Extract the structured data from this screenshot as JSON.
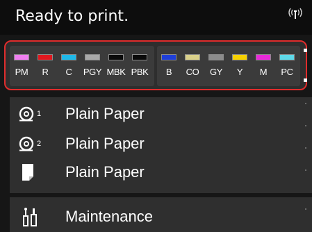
{
  "header": {
    "status_text": "Ready to print.",
    "wifi_icon": "wifi-icon"
  },
  "ink_panel": {
    "border_color": "#e02c2c",
    "left_group": [
      {
        "label": "PM",
        "color": "#f07ff0"
      },
      {
        "label": "R",
        "color": "#e0181f"
      },
      {
        "label": "C",
        "color": "#1fb8e8"
      },
      {
        "label": "PGY",
        "color": "#a9a9a9"
      },
      {
        "label": "MBK",
        "color": "#0a0a0a"
      },
      {
        "label": "PBK",
        "color": "#0a0a0a"
      }
    ],
    "right_group": [
      {
        "label": "B",
        "color": "#1f3fd8"
      },
      {
        "label": "CO",
        "color": "#d9d08a"
      },
      {
        "label": "GY",
        "color": "#8c8c8c"
      },
      {
        "label": "Y",
        "color": "#f5d000"
      },
      {
        "label": "M",
        "color": "#e82ad8"
      },
      {
        "label": "PC",
        "color": "#5ed8e8"
      }
    ]
  },
  "menu": {
    "items": [
      {
        "label": "Plain Paper",
        "icon": "roll-1-icon"
      },
      {
        "label": "Plain Paper",
        "icon": "roll-2-icon"
      },
      {
        "label": "Plain Paper",
        "icon": "cut-sheet-icon"
      },
      {
        "label": "Maintenance",
        "icon": "maintenance-icon"
      }
    ]
  }
}
